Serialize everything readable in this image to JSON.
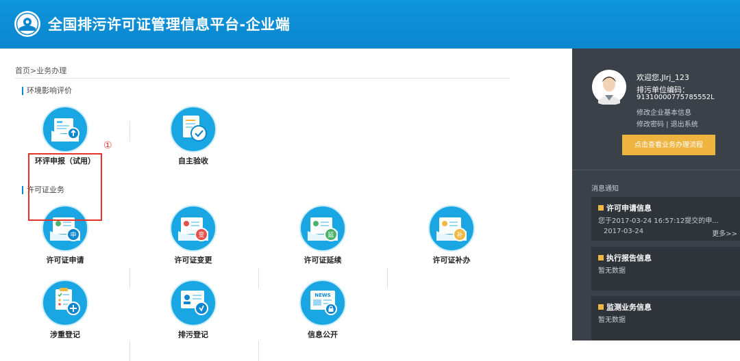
{
  "header": {
    "title": "全国排污许可证管理信息平台-企业端"
  },
  "breadcrumb": "首页>业务办理",
  "sections": {
    "env": "环境影响评价",
    "permit": "许可证业务"
  },
  "tiles": {
    "env_report": "环评申报（试用）",
    "self_accept": "自主验收",
    "permit_apply": "许可证申请",
    "permit_change": "许可证变更",
    "permit_extend": "许可证延续",
    "permit_reissue": "许可证补办",
    "involve_register": "涉重登记",
    "discharge_register": "排污登记",
    "info_public": "信息公开"
  },
  "badges": {
    "apply": "申",
    "change": "变",
    "extend": "延",
    "reissue": "补",
    "news": "NEWS"
  },
  "annotation": {
    "marker": "①",
    "color": "#e5332a"
  },
  "user": {
    "welcome": "欢迎您,Jlrj_123",
    "code_label": "排污单位编码：",
    "code_value": "91310000775785552L",
    "edit_info": "修改企业基本信息",
    "edit_pwd": "修改密码 | 退出系统",
    "flow_button": "点击查看业务办理流程"
  },
  "news": {
    "title": "消息通知",
    "cards": [
      {
        "title": "许可申请信息",
        "text": "您于2017-03-24 16:57:12提交的申...",
        "date": "2017-03-24",
        "more": "更多>>"
      },
      {
        "title": "执行报告信息",
        "text": "暂无数据"
      },
      {
        "title": "监测业务信息",
        "text": "暂无数据"
      }
    ]
  },
  "colors": {
    "header_blue": "#0b86cf",
    "sidebar": "#3b4149",
    "accent_orange": "#efb43f"
  }
}
